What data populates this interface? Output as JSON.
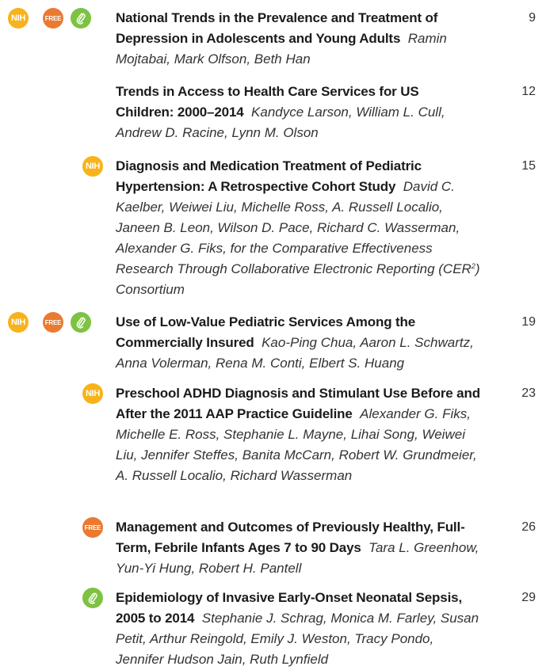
{
  "badge_labels": {
    "nih": "NIH",
    "free": "FREE"
  },
  "colors": {
    "nih": "#f7b319",
    "free": "#ea7a31",
    "supplement": "#7ec242"
  },
  "icons": {
    "supplement": "paperclip-icon"
  },
  "entries": [
    {
      "title": "National Trends in the Prevalence and Treatment of Depression in Adolescents and Young Adults",
      "authors": "Ramin Mojtabai, Mark Olfson, Beth Han",
      "page": "9",
      "badges": [
        "nih",
        "free",
        "supplement"
      ]
    },
    {
      "title": "Trends in Access to Health Care Services for US Children: 2000–2014",
      "authors": "Kandyce Larson, William L. Cull, Andrew D. Racine, Lynn M. Olson",
      "page": "12",
      "badges": []
    },
    {
      "title": "Diagnosis and Medication Treatment of Pediatric Hypertension: A Retrospective Cohort Study",
      "authors": "David C. Kaelber, Weiwei Liu, Michelle Ross, A. Russell Localio, Janeen B. Leon, Wilson D. Pace, Richard C. Wasserman, Alexander G. Fiks, for the Comparative Effectiveness Research Through Collaborative Electronic Reporting (CER",
      "authors_sup": "2",
      "authors_tail": ") Consortium",
      "page": "15",
      "badges": [
        "nih"
      ]
    },
    {
      "title": "Use of Low-Value Pediatric Services Among the Commercially Insured",
      "authors": "Kao-Ping Chua, Aaron L. Schwartz, Anna Volerman, Rena M. Conti, Elbert S. Huang",
      "page": "19",
      "badges": [
        "nih",
        "free",
        "supplement"
      ]
    },
    {
      "title": "Preschool ADHD Diagnosis and Stimulant Use Before and After the 2011 AAP Practice Guideline",
      "authors": "Alexander G. Fiks, Michelle E. Ross, Stephanie L. Mayne, Lihai Song, Weiwei Liu, Jennifer Steffes, Banita McCarn, Robert W. Grundmeier, A. Russell Localio, Richard Wasserman",
      "page": "23",
      "badges": [
        "nih"
      ]
    },
    {
      "title": "Management and Outcomes of Previously Healthy, Full-Term, Febrile Infants Ages 7 to 90 Days",
      "authors": "Tara L. Greenhow, Yun-Yi Hung, Robert H. Pantell",
      "page": "26",
      "badges": [
        "free"
      ]
    },
    {
      "title": "Epidemiology of Invasive Early-Onset Neonatal Sepsis, 2005 to 2014",
      "authors": "Stephanie J. Schrag, Monica M. Farley, Susan Petit, Arthur Reingold, Emily J. Weston, Tracy Pondo, Jennifer Hudson Jain, Ruth Lynfield",
      "page": "29",
      "badges": [
        "supplement"
      ]
    }
  ]
}
